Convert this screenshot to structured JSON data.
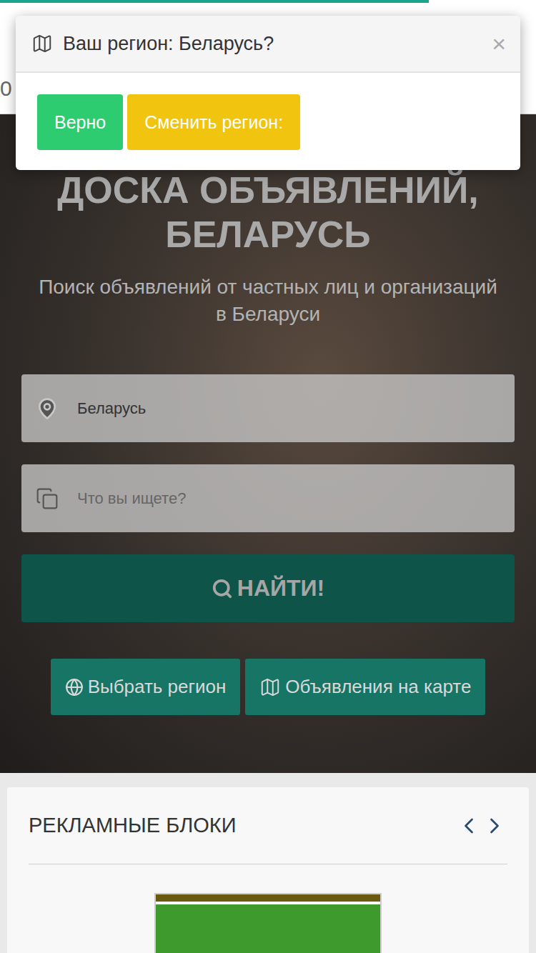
{
  "progress": {
    "level": 0.8
  },
  "header": {
    "text": "0"
  },
  "modal": {
    "title": "Ваш регион: Беларусь?",
    "close": "×",
    "buttons": [
      {
        "label": "Верно",
        "color": "#2ecc71"
      },
      {
        "label": "Сменить регион:",
        "color": "#f1c40f"
      }
    ]
  },
  "hero": {
    "title": "ДОСКА ОБЪЯВЛЕНИЙ, БЕЛАРУСЬ",
    "subtitle": "Поиск объявлений от частных лиц и организаций в Беларуси",
    "location": {
      "value": "Беларусь"
    },
    "search": {
      "placeholder": "Что вы ищете?"
    },
    "submit": "НАЙТИ!",
    "actions": [
      "Выбрать регион",
      "Объявления на карте"
    ]
  },
  "ads": {
    "title": "РЕКЛАМНЫЕ БЛОКИ"
  }
}
